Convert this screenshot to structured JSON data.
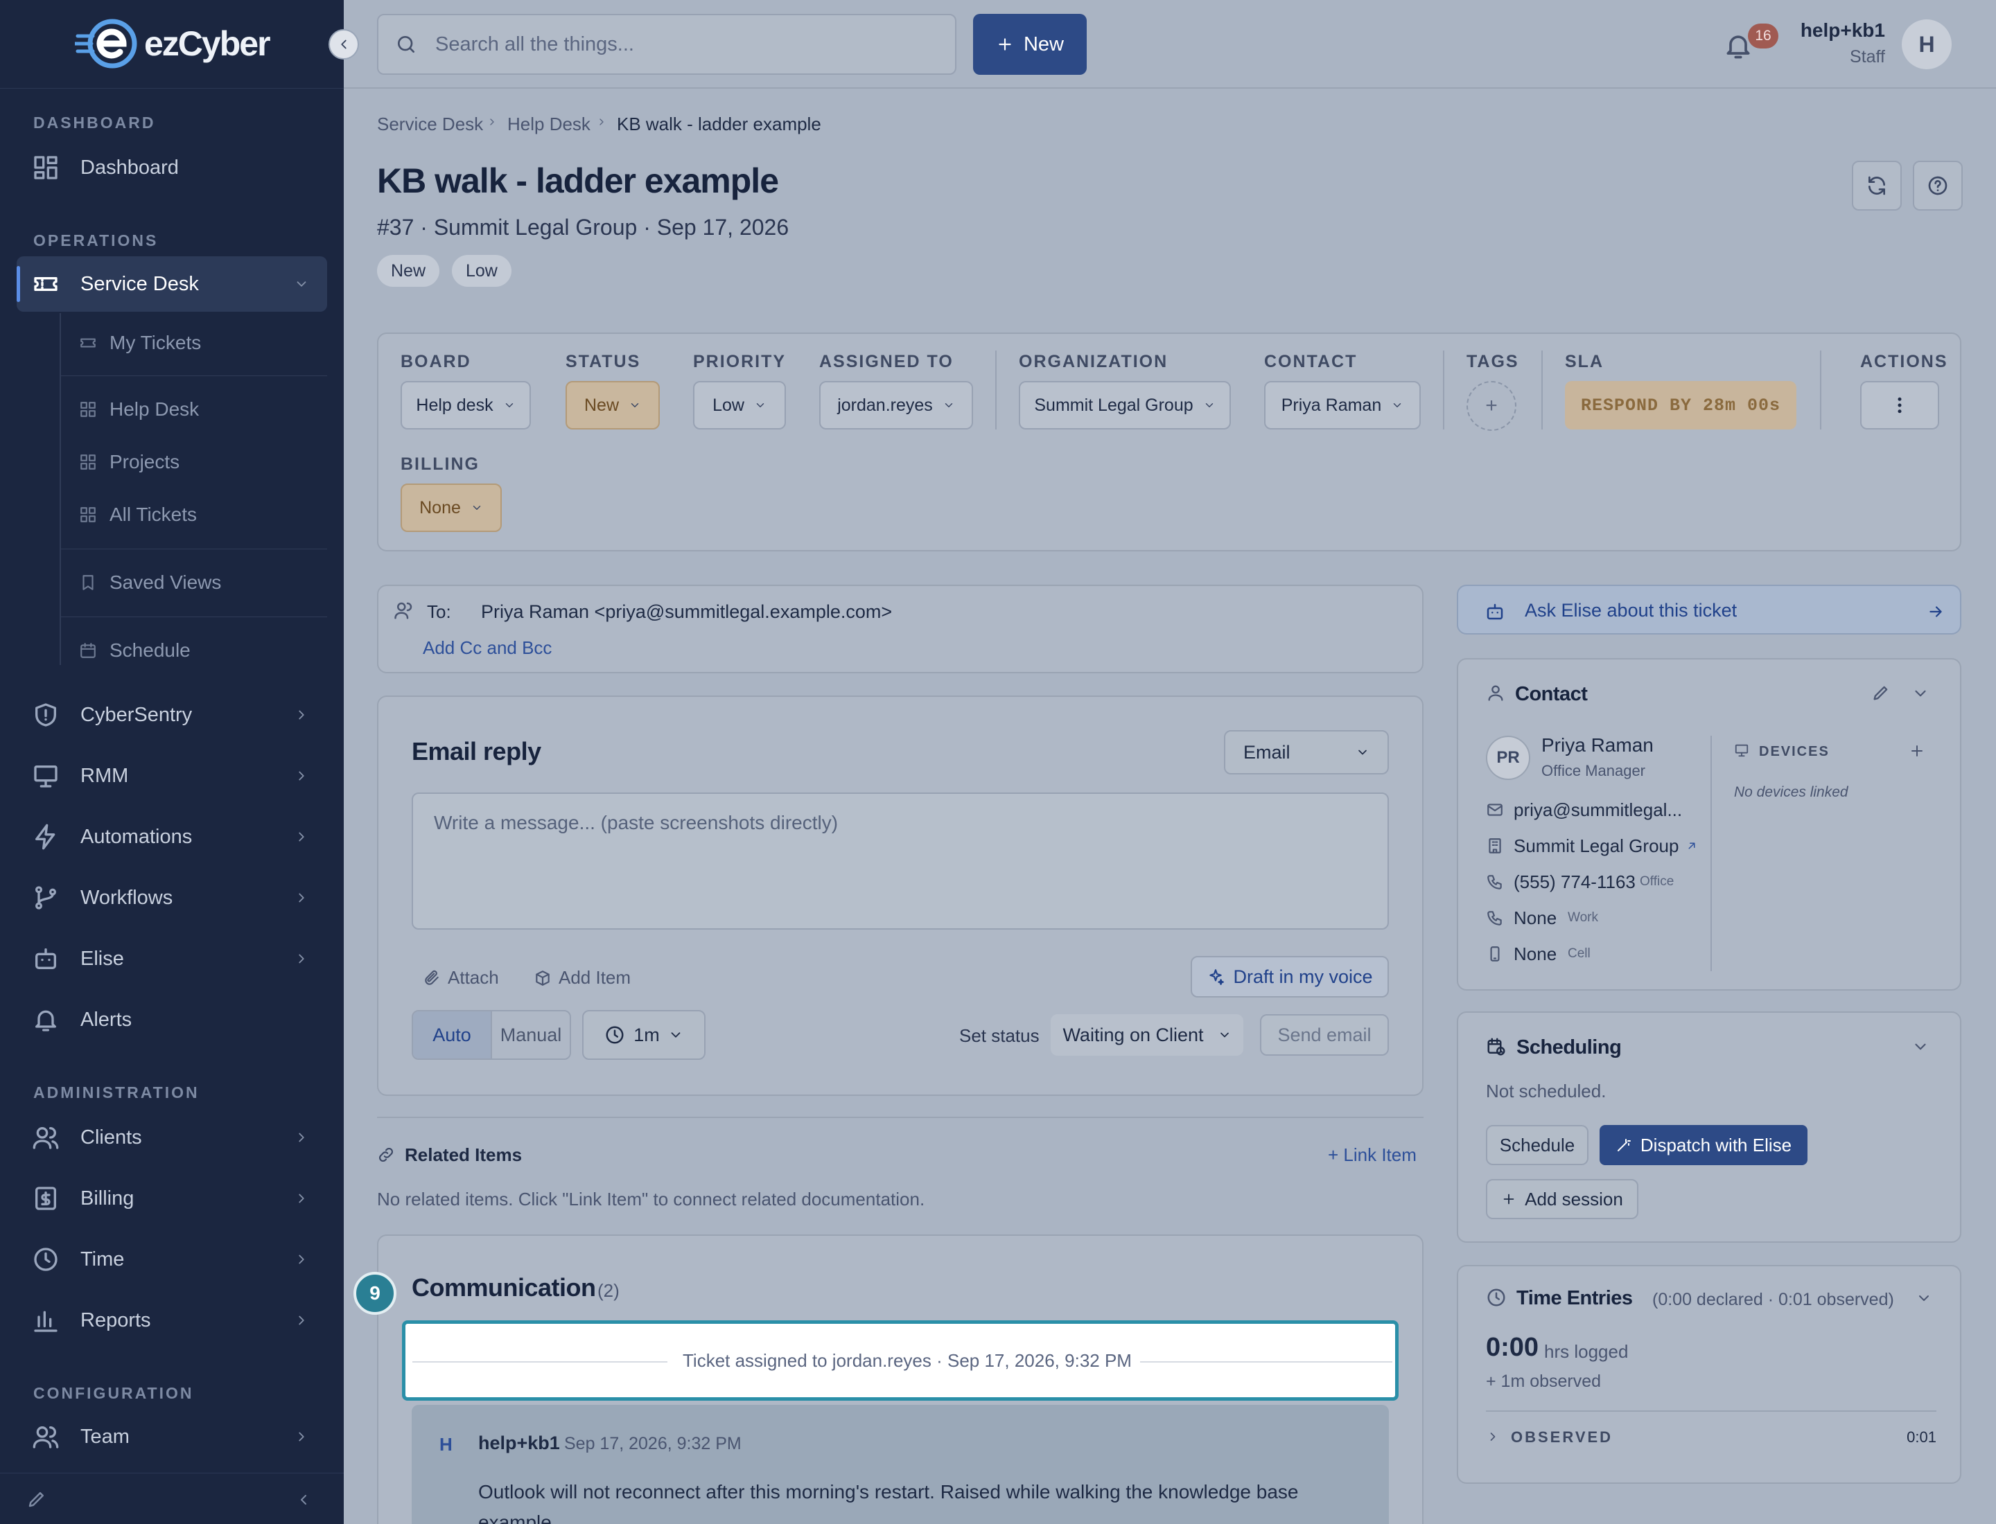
{
  "sidebar": {
    "brand": "ezCyber",
    "sections": {
      "dashboard": "DASHBOARD",
      "operations": "OPERATIONS",
      "administration": "ADMINISTRATION",
      "configuration": "CONFIGURATION"
    },
    "items": {
      "dashboard": "Dashboard",
      "service_desk": "Service Desk",
      "my_tickets": "My Tickets",
      "help_desk": "Help Desk",
      "projects": "Projects",
      "all_tickets": "All Tickets",
      "saved_views": "Saved Views",
      "schedule": "Schedule",
      "cybersentry": "CyberSentry",
      "rmm": "RMM",
      "automations": "Automations",
      "workflows": "Workflows",
      "elise": "Elise",
      "alerts": "Alerts",
      "clients": "Clients",
      "billing": "Billing",
      "time": "Time",
      "reports": "Reports",
      "team": "Team"
    }
  },
  "topbar": {
    "search_placeholder": "Search all the things...",
    "new_label": "New",
    "notifications_count": "16",
    "user_name": "help+kb1",
    "user_role": "Staff",
    "avatar_initial": "H"
  },
  "breadcrumb": [
    "Service Desk",
    "Help Desk",
    "KB walk - ladder example"
  ],
  "ticket": {
    "title": "KB walk - ladder example",
    "subtitle": "#37 · Summit Legal Group · Sep 17, 2026",
    "status_pill": "New",
    "priority_pill": "Low"
  },
  "fields": {
    "board_label": "BOARD",
    "board_value": "Help desk",
    "status_label": "STATUS",
    "status_value": "New",
    "priority_label": "PRIORITY",
    "priority_value": "Low",
    "assigned_label": "ASSIGNED TO",
    "assigned_value": "jordan.reyes",
    "org_label": "ORGANIZATION",
    "org_value": "Summit Legal Group",
    "contact_label": "CONTACT",
    "contact_value": "Priya Raman",
    "tags_label": "TAGS",
    "sla_label": "SLA",
    "sla_value": "RESPOND BY 28m 00s",
    "actions_label": "ACTIONS",
    "billing_label": "BILLING",
    "billing_value": "None"
  },
  "compose": {
    "to_label": "To:",
    "to_value": "Priya Raman <priya@summitlegal.example.com>",
    "cc_link": "Add Cc and Bcc",
    "title": "Email reply",
    "channel": "Email",
    "placeholder": "Write a message... (paste screenshots directly)",
    "attach": "Attach",
    "add_item": "Add Item",
    "draft": "Draft in my voice",
    "mode_auto": "Auto",
    "mode_manual": "Manual",
    "timer": "1m",
    "set_status_label": "Set status",
    "set_status_value": "Waiting on Client",
    "send": "Send email"
  },
  "related": {
    "title": "Related Items",
    "link_item": "+ Link Item",
    "empty": "No related items. Click \"Link Item\" to connect related documentation."
  },
  "communication": {
    "step": "9",
    "title": "Communication",
    "count": "(2)",
    "event": "Ticket assigned to jordan.reyes · Sep 17, 2026, 9:32 PM",
    "message": {
      "initial": "H",
      "author": "help+kb1",
      "time": "Sep 17, 2026, 9:32 PM",
      "body": "Outlook will not reconnect after this morning's restart. Raised while walking the knowledge base example."
    }
  },
  "elise": {
    "ask": "Ask Elise about this ticket"
  },
  "contact": {
    "title": "Contact",
    "initials": "PR",
    "name": "Priya Raman",
    "role": "Office Manager",
    "email": "priya@summitlegal...",
    "org": "Summit Legal Group",
    "phone": "(555) 774-1163",
    "phone_tag": "Office",
    "work": "None",
    "work_tag": "Work",
    "cell": "None",
    "cell_tag": "Cell",
    "devices_label": "DEVICES",
    "devices_empty": "No devices linked"
  },
  "scheduling": {
    "title": "Scheduling",
    "status": "Not scheduled.",
    "schedule_btn": "Schedule",
    "dispatch_btn": "Dispatch with Elise",
    "add_session": "Add session"
  },
  "time_entries": {
    "title": "Time Entries",
    "summary": "(0:00 declared · 0:01 observed)",
    "hours": "0:00",
    "hours_label": "hrs logged",
    "observed_note": "+ 1m observed",
    "observed_label": "OBSERVED",
    "observed_value": "0:01"
  },
  "colors": {
    "sidebar_bg": "#1b2640",
    "primary": "#2d4a86",
    "highlight": "#2a8fa8",
    "sla_warn": "#c8b59c"
  }
}
